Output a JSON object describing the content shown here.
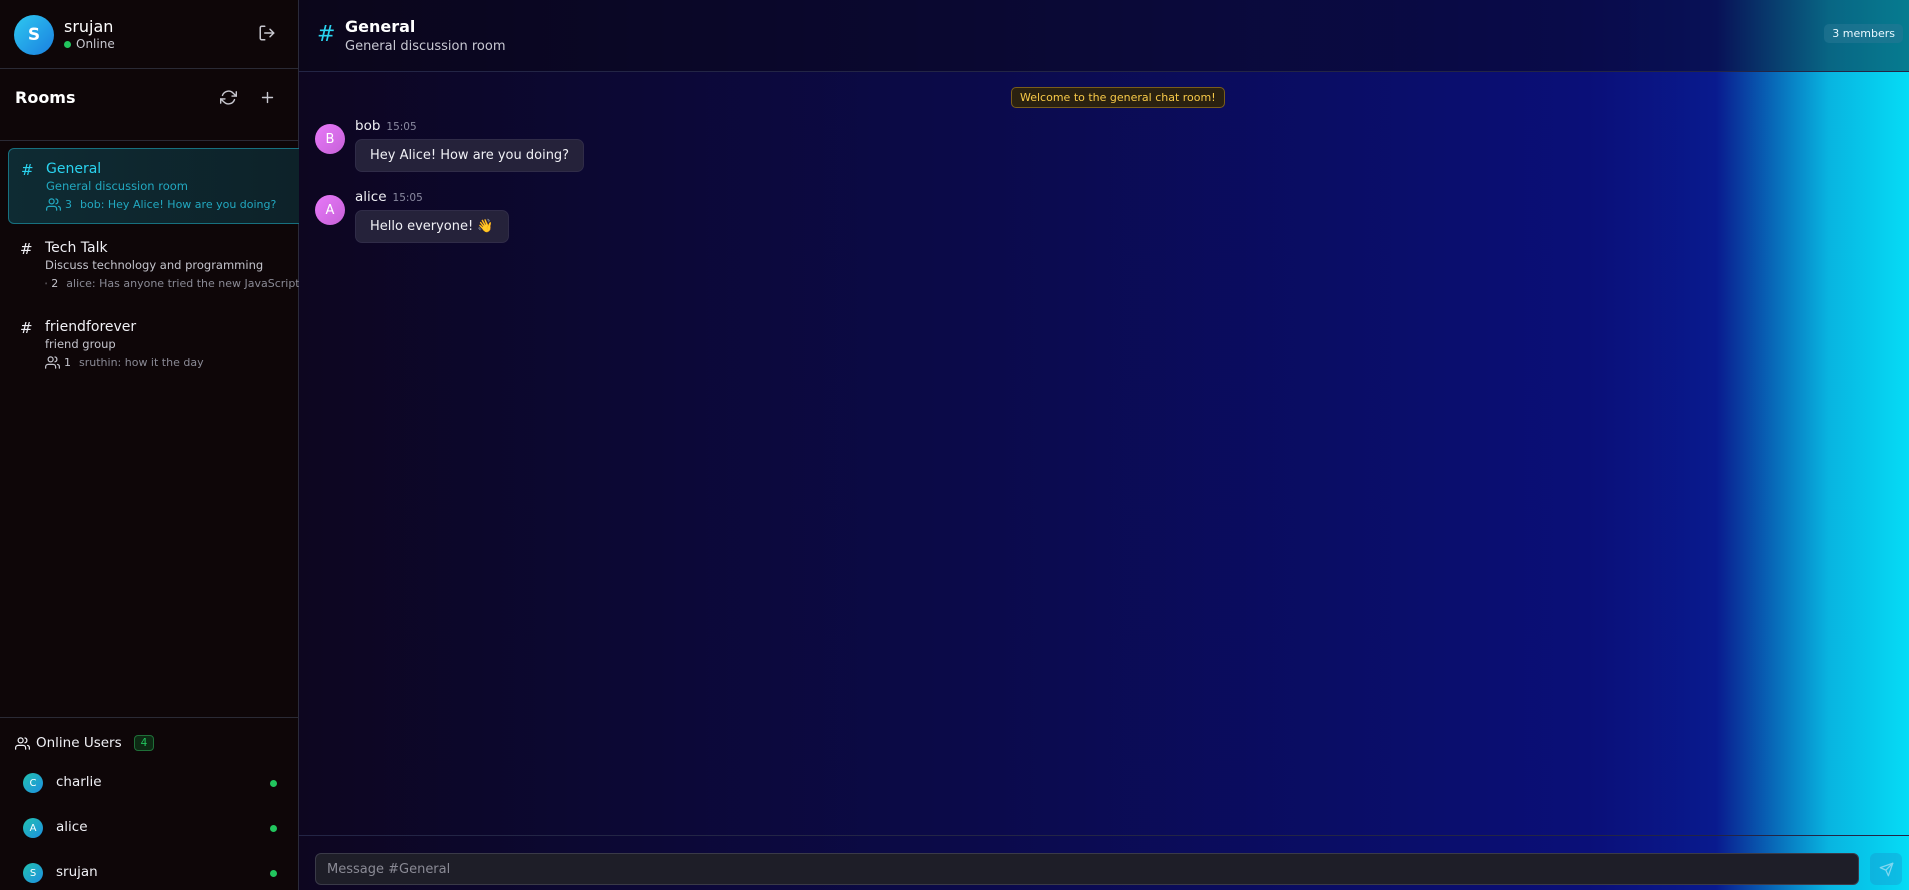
{
  "user": {
    "initial": "S",
    "name": "srujan",
    "status": "Online"
  },
  "rooms_panel": {
    "title": "Rooms",
    "rooms": [
      {
        "hash": "#",
        "name": "General",
        "description": "General discussion room",
        "member_count": "3",
        "last_message": "bob: Hey Alice! How are you doing?"
      },
      {
        "hash": "#",
        "name": "Tech Talk",
        "description": "Discuss technology and programming",
        "member_count": "2",
        "last_message": "alice: Has anyone tried the new JavaScript f"
      },
      {
        "hash": "#",
        "name": "friendforever",
        "description": "friend group",
        "member_count": "1",
        "last_message": "sruthin: how it the day"
      }
    ]
  },
  "online_users": {
    "title": "Online Users",
    "count": "4",
    "users": [
      {
        "initial": "C",
        "name": "charlie"
      },
      {
        "initial": "A",
        "name": "alice"
      },
      {
        "initial": "S",
        "name": "srujan"
      }
    ]
  },
  "chat": {
    "hash": "#",
    "title": "General",
    "subtitle": "General discussion room",
    "members": "3 members",
    "welcome": "Welcome to the general chat room!",
    "messages": [
      {
        "initial": "B",
        "author": "bob",
        "time": "15:05",
        "text": "Hey Alice! How are you doing?"
      },
      {
        "initial": "A",
        "author": "alice",
        "time": "15:05",
        "text": "Hello everyone! 👋"
      }
    ],
    "input_placeholder": "Message #General"
  },
  "colors": {
    "accent": "#2ad3ef",
    "online": "#22c55e",
    "welcome": "#f7c948"
  }
}
